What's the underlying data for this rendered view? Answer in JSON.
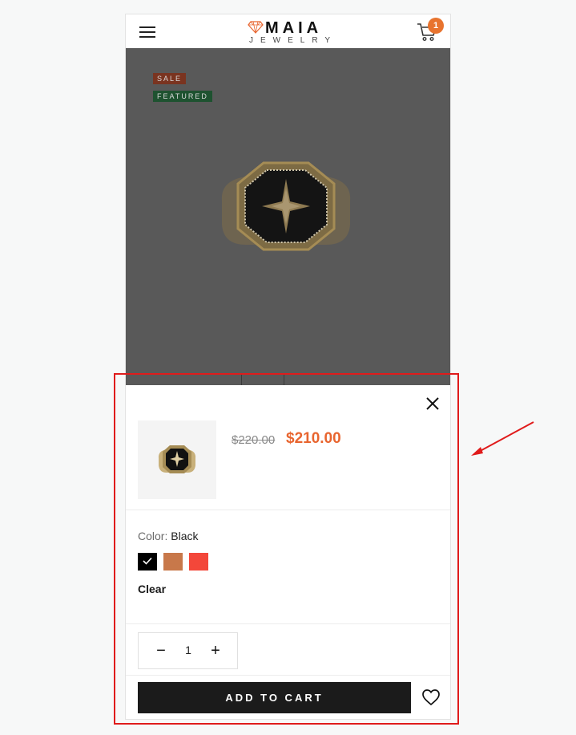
{
  "header": {
    "logo": {
      "name": "MAIA",
      "subtitle": "JEWELRY"
    },
    "cart_count": "1",
    "icons": {
      "menu": "hamburger-menu-icon",
      "cart": "cart-icon",
      "logo": "diamond-logo-icon"
    }
  },
  "product": {
    "badges": {
      "sale": "SALE",
      "featured": "FEATURED"
    },
    "price_old": "$220.00",
    "price_new": "$210.00"
  },
  "variant": {
    "label": "Color:",
    "selected": "Black",
    "swatches": [
      {
        "name": "Black",
        "color": "#000000",
        "selected": true
      },
      {
        "name": "Brown",
        "color": "#c8784a",
        "selected": false
      },
      {
        "name": "Red",
        "color": "#f3473a",
        "selected": false
      }
    ],
    "clear_label": "Clear"
  },
  "quantity": {
    "value": "1",
    "minus": "−",
    "plus": "+"
  },
  "actions": {
    "add_to_cart": "ADD TO CART",
    "icons": {
      "close": "close-icon",
      "wishlist": "heart-icon"
    }
  },
  "colors": {
    "accent": "#e8652f",
    "badge": "#e8732e",
    "highlight": "#e01b1b",
    "button": "#1b1b1b"
  }
}
